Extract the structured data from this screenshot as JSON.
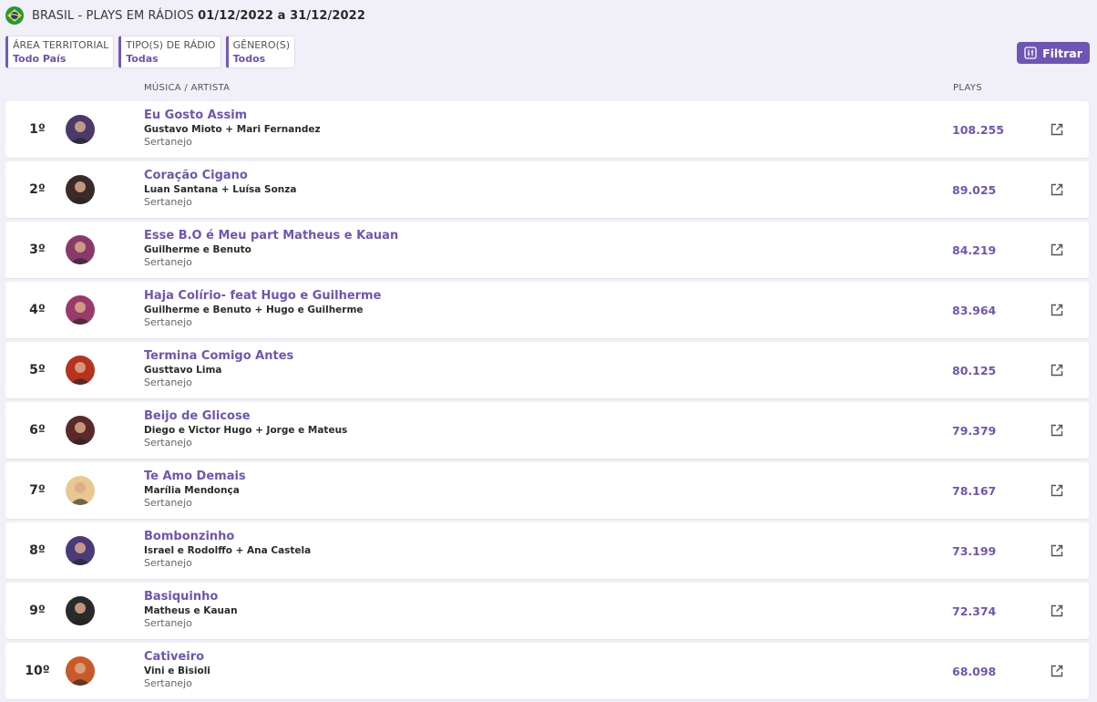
{
  "header": {
    "flag_icon": "brazil-flag-icon",
    "title": "BRASIL - PLAYS EM RÁDIOS",
    "period": "01/12/2022 a 31/12/2022"
  },
  "filters": [
    {
      "label": "ÁREA TERRITORIAL",
      "value": "Todo País"
    },
    {
      "label": "TIPO(S) DE RÁDIO",
      "value": "Todas"
    },
    {
      "label": "GÊNERO(S)",
      "value": "Todos"
    }
  ],
  "filter_button": {
    "label": "Filtrar",
    "icon": "sliders-icon"
  },
  "columns": {
    "music_artist": "MÚSICA / ARTISTA",
    "plays": "PLAYS"
  },
  "colors": {
    "accent": "#6e55b5",
    "background": "#f1eff7"
  },
  "ranking": [
    {
      "position": "1º",
      "song": "Eu Gosto Assim",
      "artist": "Gustavo Mioto + Mari Fernandez",
      "genre": "Sertanejo",
      "plays": "108.255",
      "avatar_color": "#4a3a6a"
    },
    {
      "position": "2º",
      "song": "Coração Cigano",
      "artist": "Luan Santana + Luísa Sonza",
      "genre": "Sertanejo",
      "plays": "89.025",
      "avatar_color": "#3a2a2a"
    },
    {
      "position": "3º",
      "song": "Esse B.O é Meu part Matheus e Kauan",
      "artist": "Guilherme e Benuto",
      "genre": "Sertanejo",
      "plays": "84.219",
      "avatar_color": "#8a3a6a"
    },
    {
      "position": "4º",
      "song": "Haja Colírio- feat Hugo e Guilherme",
      "artist": "Guilherme e Benuto + Hugo e Guilherme",
      "genre": "Sertanejo",
      "plays": "83.964",
      "avatar_color": "#9a3a6a"
    },
    {
      "position": "5º",
      "song": "Termina Comigo Antes",
      "artist": "Gusttavo Lima",
      "genre": "Sertanejo",
      "plays": "80.125",
      "avatar_color": "#b8321e"
    },
    {
      "position": "6º",
      "song": "Beijo de Glicose",
      "artist": "Diego e Victor Hugo + Jorge e Mateus",
      "genre": "Sertanejo",
      "plays": "79.379",
      "avatar_color": "#5a2a2a"
    },
    {
      "position": "7º",
      "song": "Te Amo Demais",
      "artist": "Marília Mendonça",
      "genre": "Sertanejo",
      "plays": "78.167",
      "avatar_color": "#e8c890"
    },
    {
      "position": "8º",
      "song": "Bombonzinho",
      "artist": "Israel e Rodolffo + Ana Castela",
      "genre": "Sertanejo",
      "plays": "73.199",
      "avatar_color": "#4a3a7a"
    },
    {
      "position": "9º",
      "song": "Basiquinho",
      "artist": "Matheus e Kauan",
      "genre": "Sertanejo",
      "plays": "72.374",
      "avatar_color": "#2a2a2a"
    },
    {
      "position": "10º",
      "song": "Cativeiro",
      "artist": "Vini e Bisioli",
      "genre": "Sertanejo",
      "plays": "68.098",
      "avatar_color": "#c85a2a"
    }
  ]
}
